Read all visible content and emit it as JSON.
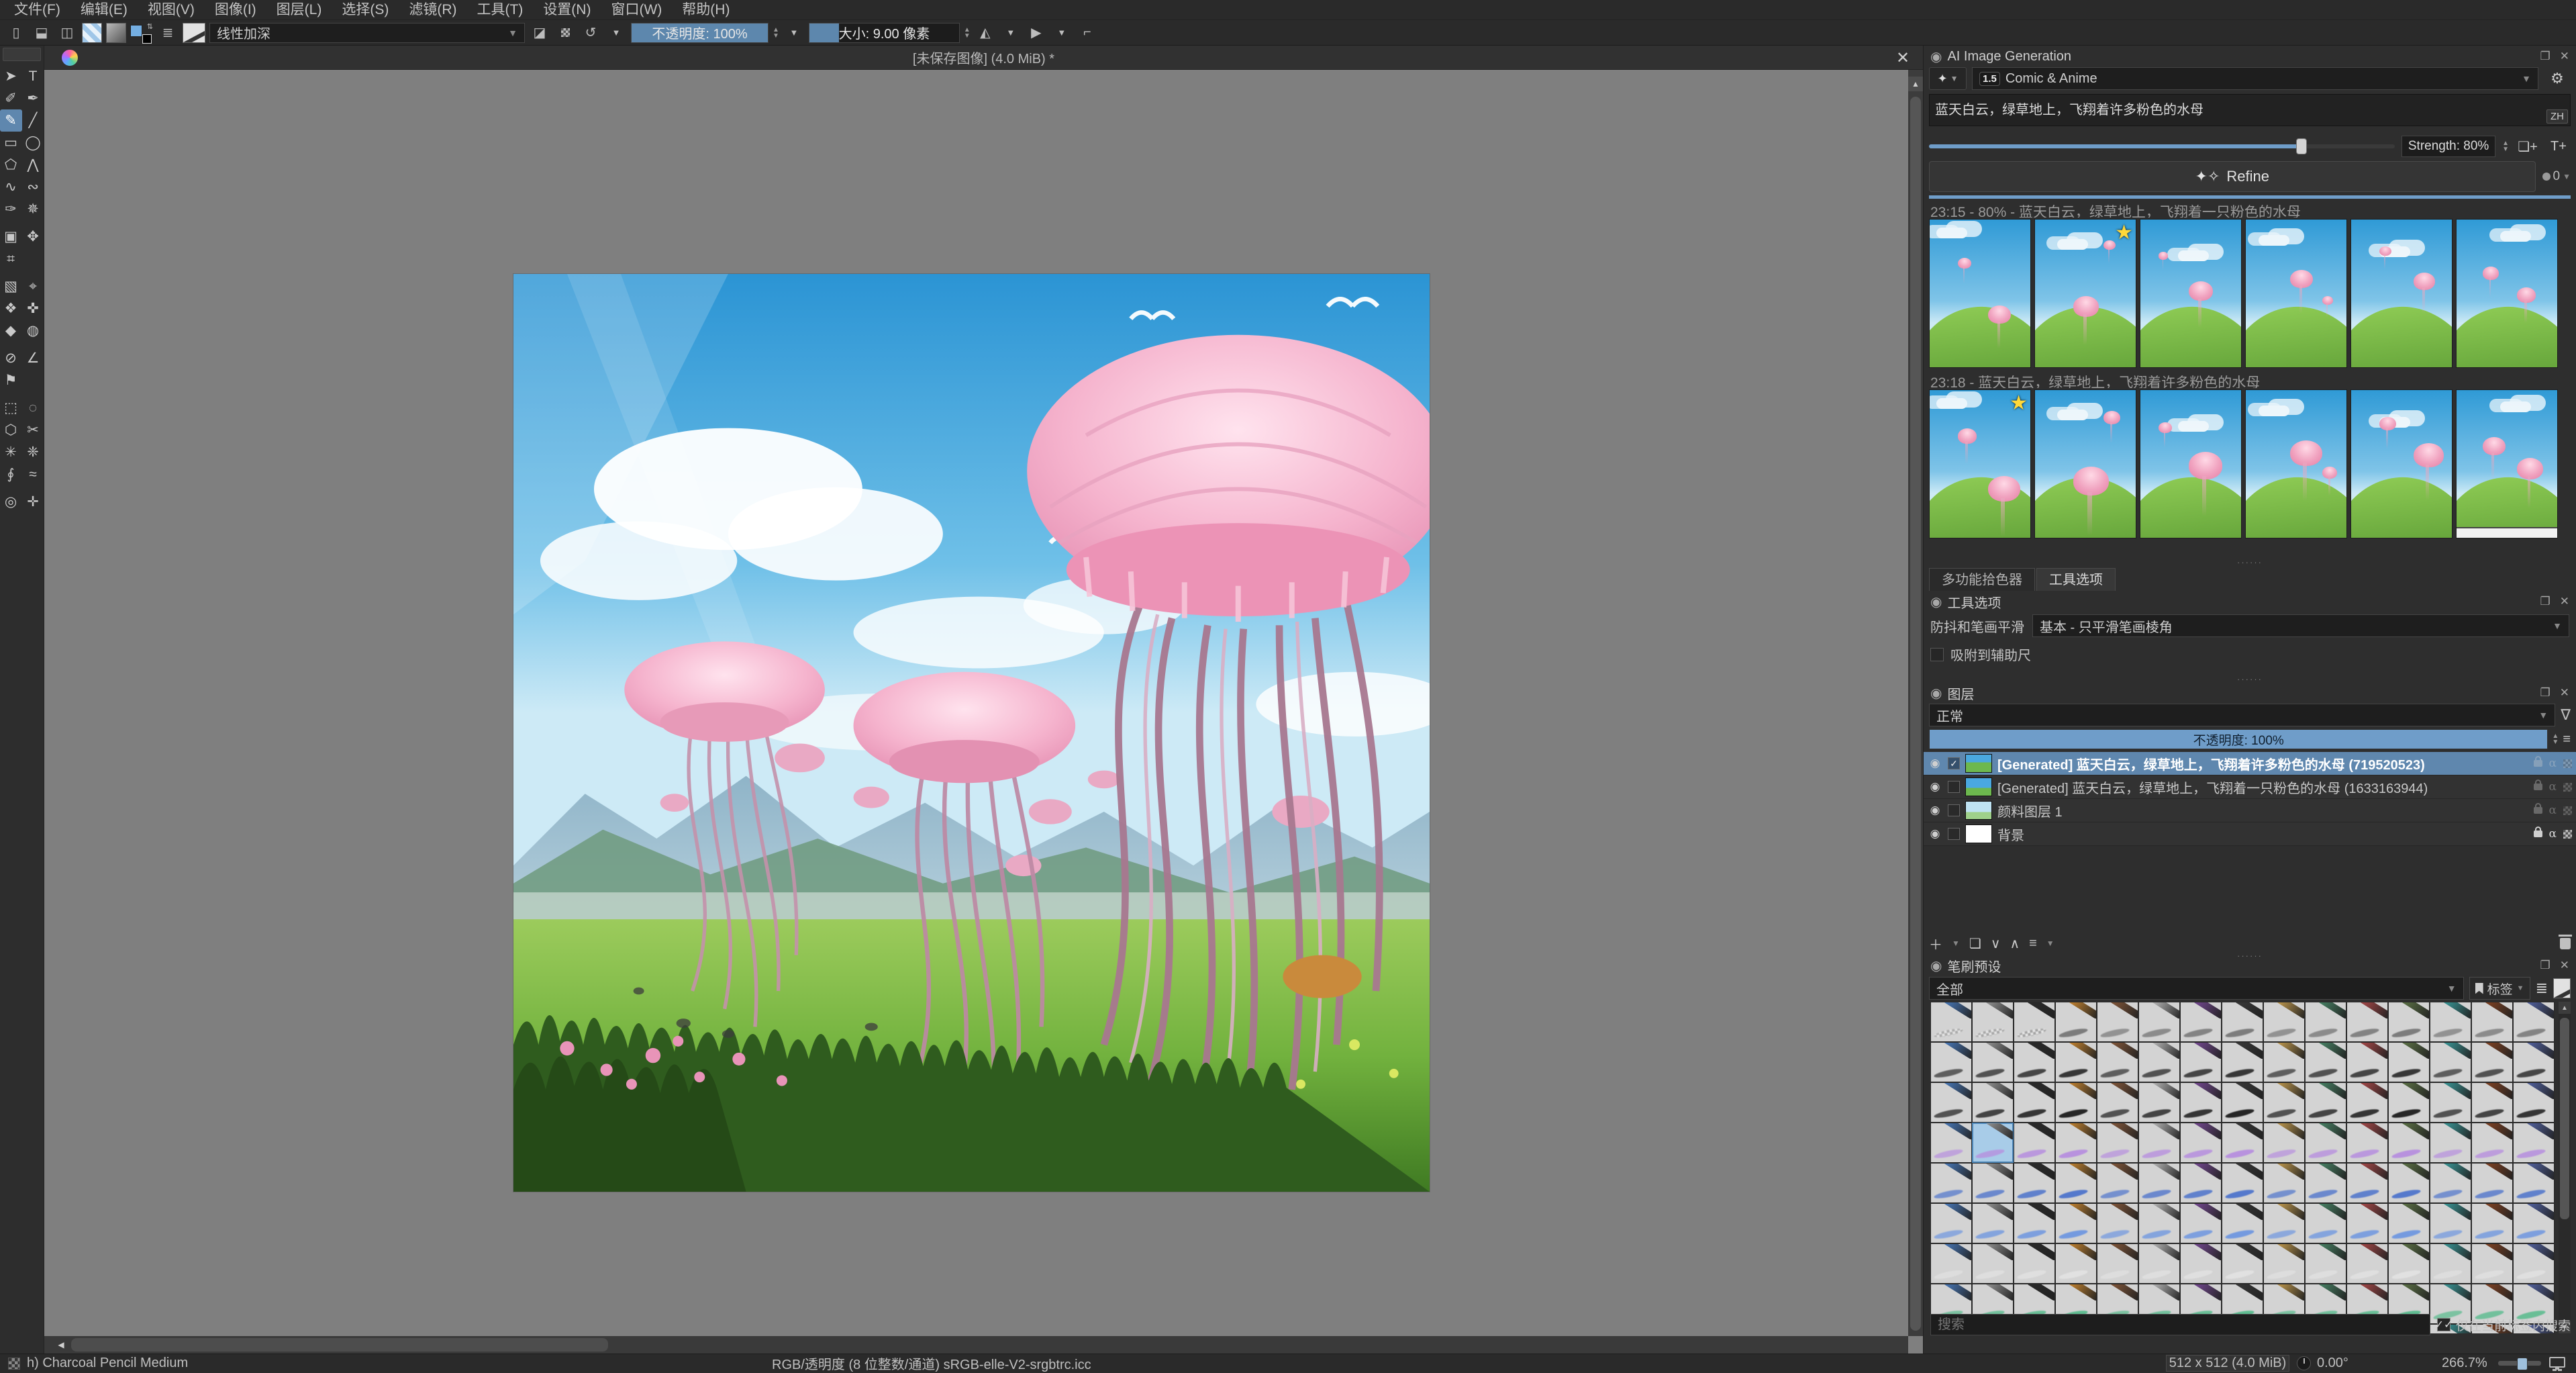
{
  "menu": {
    "items": [
      "文件(F)",
      "编辑(E)",
      "视图(V)",
      "图像(I)",
      "图层(L)",
      "选择(S)",
      "滤镜(R)",
      "工具(T)",
      "设置(N)",
      "窗口(W)",
      "帮助(H)"
    ]
  },
  "toolbar": {
    "blend_mode": "线性加深",
    "opacity_text": "不透明度:  100%",
    "size_text": "大小:  9.00 像素"
  },
  "subwindow": {
    "title": "[未保存图像] (4.0 MiB) *",
    "close_glyph": "✕"
  },
  "toolbox": {
    "tools": [
      {
        "name": "select-shapes-tool",
        "glyph": "➤"
      },
      {
        "name": "text-tool",
        "glyph": "T"
      },
      {
        "name": "edit-shapes-tool",
        "glyph": "✐"
      },
      {
        "name": "calligraphy-tool",
        "glyph": "✒"
      },
      {
        "name": "freehand-brush-tool",
        "glyph": "✎",
        "selected": true
      },
      {
        "name": "line-tool",
        "glyph": "╱"
      },
      {
        "name": "rectangle-tool",
        "glyph": "▭"
      },
      {
        "name": "ellipse-tool",
        "glyph": "◯"
      },
      {
        "name": "polygon-tool",
        "glyph": "⬠"
      },
      {
        "name": "polyline-tool",
        "glyph": "⋀"
      },
      {
        "name": "bezier-curve-tool",
        "glyph": "∿"
      },
      {
        "name": "freehand-path-tool",
        "glyph": "∾"
      },
      {
        "name": "dynamic-brush-tool",
        "glyph": "✑"
      },
      {
        "name": "multibrush-tool",
        "glyph": "✵"
      },
      {
        "name": "transform-tool",
        "glyph": "▣"
      },
      {
        "name": "move-tool",
        "glyph": "✥"
      },
      {
        "name": "crop-tool",
        "glyph": "⌗"
      },
      {
        "name": "",
        "glyph": ""
      },
      {
        "name": "gradient-tool",
        "glyph": "▧"
      },
      {
        "name": "color-sampler-tool",
        "glyph": "⌖"
      },
      {
        "name": "pattern-edit-tool",
        "glyph": "❖"
      },
      {
        "name": "smart-patch-tool",
        "glyph": "✜"
      },
      {
        "name": "fill-tool",
        "glyph": "◆"
      },
      {
        "name": "enclose-fill-tool",
        "glyph": "◍"
      },
      {
        "name": "assistants-tool",
        "glyph": "⊘"
      },
      {
        "name": "measure-tool",
        "glyph": "∠"
      },
      {
        "name": "reference-images-tool",
        "glyph": "⚑"
      },
      {
        "name": "",
        "glyph": ""
      },
      {
        "name": "rect-select-tool",
        "glyph": "⬚"
      },
      {
        "name": "ellipse-select-tool",
        "glyph": "◌"
      },
      {
        "name": "polygon-select-tool",
        "glyph": "⬡"
      },
      {
        "name": "freehand-select-tool",
        "glyph": "✂"
      },
      {
        "name": "magic-wand-select-tool",
        "glyph": "✳"
      },
      {
        "name": "similar-select-tool",
        "glyph": "❈"
      },
      {
        "name": "bezier-select-tool",
        "glyph": "∮"
      },
      {
        "name": "magnetic-select-tool",
        "glyph": "≈"
      },
      {
        "name": "zoom-tool",
        "glyph": "◎"
      },
      {
        "name": "pan-tool",
        "glyph": "✛"
      }
    ]
  },
  "ai_panel": {
    "title": "AI Image Generation",
    "style_badge": "1.5",
    "style_name": "Comic & Anime",
    "prompt": "蓝天白云，绿草地上，飞翔着许多粉色的水母",
    "lang_button": "ZH",
    "strength_label": "Strength: 80%",
    "strength_percent": 80,
    "refine_label": "Refine",
    "queue_count": "0",
    "history": [
      {
        "label": "23:15 - 80% - 蓝天白云，绿草地上，飞翔着一只粉色的水母",
        "thumb_count": 6,
        "starred_thumb": 2
      },
      {
        "label": "23:18 - 蓝天白云，绿草地上，飞翔着许多粉色的水母",
        "thumb_count": 6,
        "starred_thumb": 1
      }
    ]
  },
  "docker_tabs": {
    "tab1": "多功能拾色器",
    "tab2": "工具选项"
  },
  "tool_options": {
    "title": "工具选项",
    "smoothing_label": "防抖和笔画平滑",
    "smoothing_value": "基本 - 只平滑笔画棱角",
    "snap_label": "吸附到辅助尺",
    "snap_checked": false
  },
  "layers_panel": {
    "title": "图层",
    "blend_mode": "正常",
    "opacity_text": "不透明度:  100%",
    "layers": [
      {
        "name": "[Generated] 蓝天白云，绿草地上，飞翔着许多粉色的水母 (719520523)",
        "selected": true,
        "checked": true,
        "locked": false,
        "thumb": "many"
      },
      {
        "name": "[Generated] 蓝天白云，绿草地上，飞翔着一只粉色的水母 (1633163944)",
        "selected": false,
        "checked": false,
        "locked": false,
        "thumb": "one"
      },
      {
        "name": "颜料图层 1",
        "selected": false,
        "checked": false,
        "locked": false,
        "thumb": "paint"
      },
      {
        "name": "背景",
        "selected": false,
        "checked": false,
        "locked": true,
        "thumb": "white"
      }
    ]
  },
  "brush_panel": {
    "title": "笔刷预设",
    "filter_value": "全部",
    "tag_button": "标签",
    "search_placeholder": "搜索",
    "search_scope_label": "仅在当前标签内搜索",
    "search_scope_checked": true,
    "grid": {
      "columns": 15,
      "rows": 9,
      "selected_row": 4,
      "selected_col": 2,
      "row_stroke_colors": [
        "#777777",
        "#2e2e2e",
        "#1c1c1c",
        "#b78fdf",
        "#4e74cc",
        "#6f97e0",
        "#e2e2e2",
        "#58bb8d",
        "#5a4636"
      ],
      "tool_colors": [
        "#4a7ec4",
        "#9a9a9a",
        "#2b2b2b",
        "#d08a30",
        "#8a5a3a",
        "#c0c0c0",
        "#7a4a9a",
        "#3a3a3a",
        "#caa050",
        "#4a8a6a",
        "#b04a4a",
        "#607848",
        "#3aa0a0",
        "#884422",
        "#5566aa"
      ]
    }
  },
  "statusbar": {
    "tool_preset": "h) Charcoal Pencil Medium",
    "colorspace": "RGB/透明度 (8 位整数/通道)  sRGB-elle-V2-srgbtrc.icc",
    "doc_size": "512 x 512 (4.0 MiB)",
    "rotation": "0.00°",
    "zoom": "266.7%"
  },
  "colors": {
    "accent_blue": "#6f9dc9",
    "selection_blue": "#5f87ae",
    "canvas_gutter": "#7f7f7f"
  }
}
